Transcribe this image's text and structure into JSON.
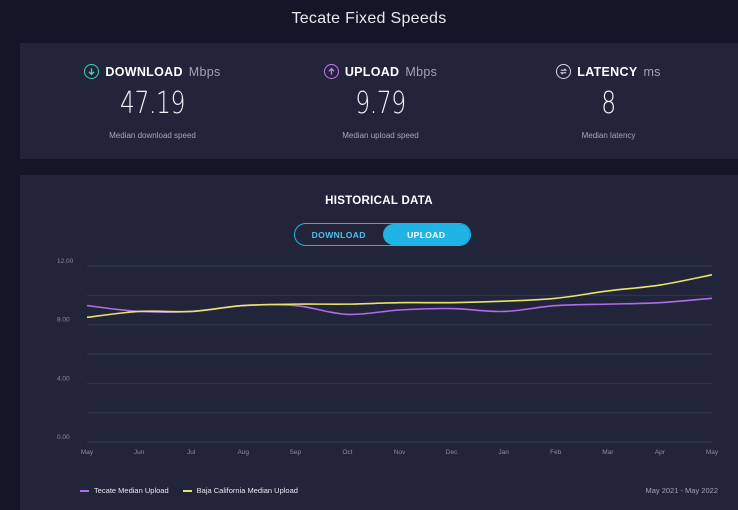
{
  "page": {
    "title": "Tecate Fixed Speeds"
  },
  "metrics": {
    "download": {
      "label": "DOWNLOAD",
      "unit": "Mbps",
      "value": "47.19",
      "caption": "Median download speed",
      "icon": "arrow-down-circle-icon",
      "color": "#3dd3ae"
    },
    "upload": {
      "label": "UPLOAD",
      "unit": "Mbps",
      "value": "9.79",
      "caption": "Median upload speed",
      "icon": "arrow-up-circle-icon",
      "color": "#c07af0"
    },
    "latency": {
      "label": "LATENCY",
      "unit": "ms",
      "value": "8",
      "caption": "Median latency",
      "icon": "ping-circle-icon",
      "color": "#d7d8e2"
    }
  },
  "history": {
    "title": "HISTORICAL DATA",
    "toggle": {
      "download_label": "DOWNLOAD",
      "upload_label": "UPLOAD",
      "selected": "UPLOAD"
    },
    "date_range": "May 2021 - May 2022"
  },
  "chart_data": {
    "type": "line",
    "categories": [
      "May",
      "Jun",
      "Jul",
      "Aug",
      "Sep",
      "Oct",
      "Nov",
      "Dec",
      "Jan",
      "Feb",
      "Mar",
      "Apr",
      "May"
    ],
    "y_ticks": [
      "0.00",
      "4.00",
      "8.00",
      "12.00"
    ],
    "ylim": [
      0,
      12
    ],
    "grid": true,
    "legend_position": "bottom-left",
    "series": [
      {
        "name": "Tecate Median Upload",
        "color": "#b06be8",
        "values": [
          9.3,
          8.9,
          8.9,
          9.3,
          9.3,
          8.7,
          9.0,
          9.1,
          8.9,
          9.3,
          9.4,
          9.5,
          9.8
        ]
      },
      {
        "name": "Baja California Median Upload",
        "color": "#e8e36a",
        "values": [
          8.5,
          8.9,
          8.9,
          9.3,
          9.4,
          9.4,
          9.5,
          9.5,
          9.6,
          9.8,
          10.3,
          10.7,
          11.4
        ]
      }
    ]
  }
}
